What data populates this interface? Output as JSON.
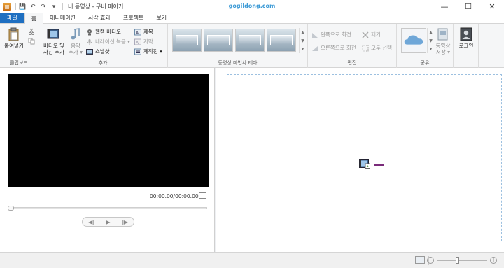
{
  "window": {
    "title": "내 동영상 - 무비 메이커",
    "watermark": "gogildong.com",
    "controls": {
      "minimize": "—",
      "maximize": "☐",
      "close": "✕"
    }
  },
  "qat": {
    "save": "💾",
    "undo": "↶",
    "redo": "↷",
    "menu": "▾"
  },
  "tabs": [
    "파일",
    "홈",
    "애니메이션",
    "시각 효과",
    "프로젝트",
    "보기"
  ],
  "groups": {
    "clipboard": {
      "label": "클립보드",
      "paste": "붙여넣기"
    },
    "add": {
      "label": "추가",
      "add_media": "비디오 및\n사진 추가",
      "add_music": "음악\n추가 ▾",
      "webcam": "웹캠 비디오",
      "narration": "내레이션 녹음 ▾",
      "snapshot": "스냅샷",
      "title": "제목",
      "caption": "자막",
      "credits": "제작진 ▾"
    },
    "themes": {
      "label": "동영상 마법사 테마"
    },
    "editing": {
      "label": "편집",
      "rotate_left": "왼쪽으로 회전",
      "rotate_right": "오른쪽으로 회전",
      "remove": "제거",
      "select_all": "모두 선택"
    },
    "share": {
      "label": "공유",
      "save_movie": "동영상\n저장 ▾"
    },
    "signin": {
      "label": "로그인"
    }
  },
  "player": {
    "timecode": "00:00.00/00:00.00",
    "prev_frame": "◀|",
    "play": "▶",
    "next_frame": "|▶"
  },
  "zoom": {
    "minus": "−",
    "plus": "+",
    "level": 0.4
  },
  "colors": {
    "file_tab": "#1e6fc1",
    "accent": "#3c9ad6",
    "video_bg": "#000000"
  }
}
